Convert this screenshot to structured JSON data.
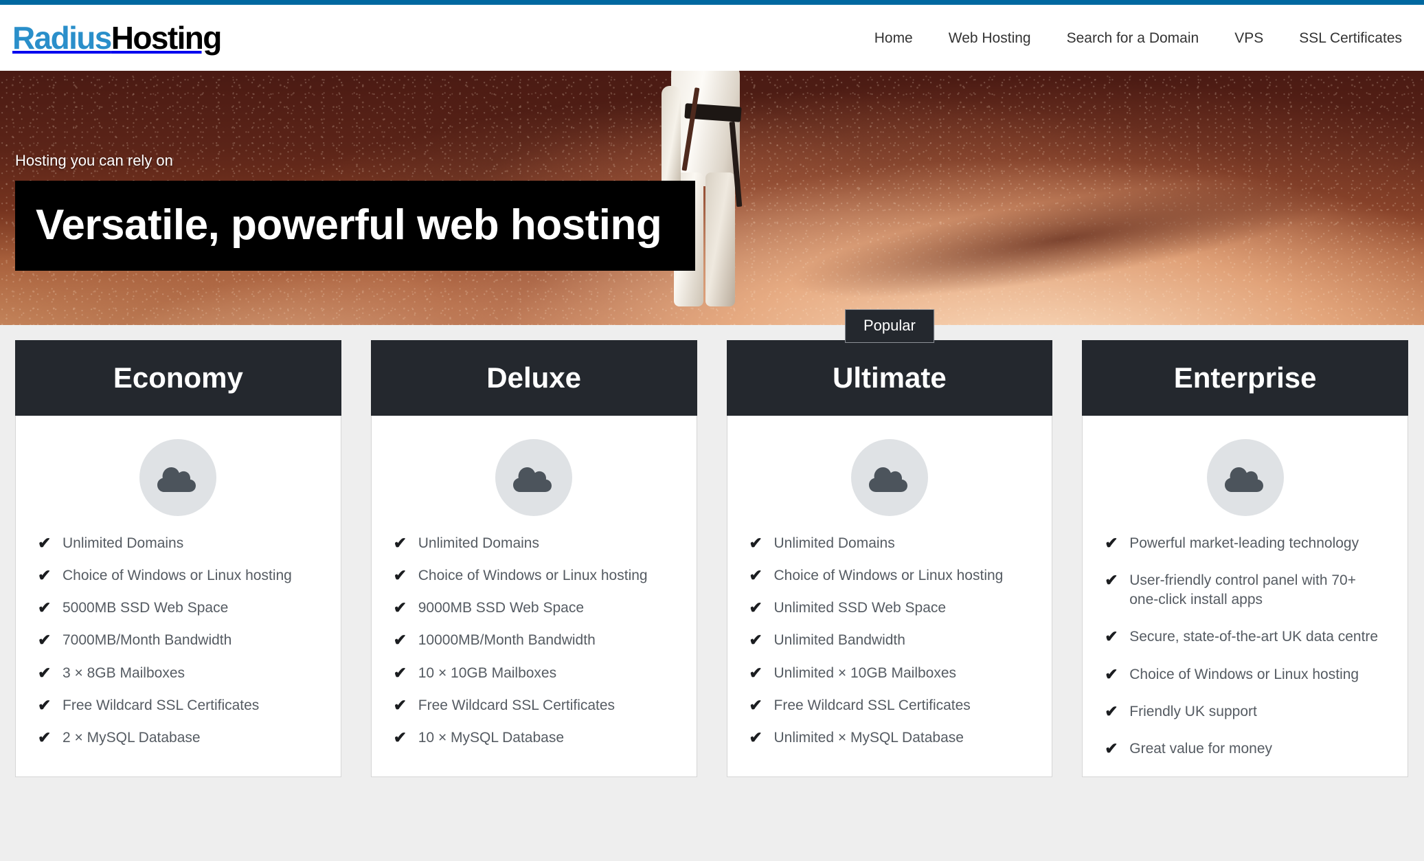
{
  "topbar": {
    "color": "#0068a0"
  },
  "header": {
    "logo": {
      "primary": "Radius",
      "secondary": "Hosting",
      "primary_color": "#2a8fca",
      "secondary_color": "#000000"
    },
    "nav": [
      {
        "label": "Home"
      },
      {
        "label": "Web Hosting"
      },
      {
        "label": "Search for a Domain"
      },
      {
        "label": "VPS"
      },
      {
        "label": "SSL Certificates"
      }
    ]
  },
  "hero": {
    "kicker": "Hosting you can rely on",
    "title": "Versatile, powerful web hosting",
    "image_description": "person in white protective suit standing on red rocky martian-like terrain"
  },
  "plans": {
    "badge_label": "Popular",
    "check_glyph": "✔",
    "icon_name": "cloud-icon",
    "cards": [
      {
        "name": "Economy",
        "popular": false,
        "features": [
          "Unlimited Domains",
          "Choice of Windows or Linux hosting",
          "5000MB SSD Web Space",
          "7000MB/Month Bandwidth",
          "3 × 8GB Mailboxes",
          "Free Wildcard SSL Certificates",
          "2 × MySQL Database"
        ]
      },
      {
        "name": "Deluxe",
        "popular": false,
        "features": [
          "Unlimited Domains",
          "Choice of Windows or Linux hosting",
          "9000MB SSD Web Space",
          "10000MB/Month Bandwidth",
          "10 × 10GB Mailboxes",
          "Free Wildcard SSL Certificates",
          "10 × MySQL Database"
        ]
      },
      {
        "name": "Ultimate",
        "popular": true,
        "features": [
          "Unlimited Domains",
          "Choice of Windows or Linux hosting",
          "Unlimited SSD Web Space",
          "Unlimited Bandwidth",
          "Unlimited × 10GB Mailboxes",
          "Free Wildcard SSL Certificates",
          "Unlimited × MySQL Database"
        ]
      },
      {
        "name": "Enterprise",
        "popular": false,
        "features": [
          "Powerful market-leading technology",
          "User-friendly control panel with 70+ one-click install apps",
          "Secure, state-of-the-art UK data centre",
          "Choice of Windows or Linux hosting",
          "Friendly UK support",
          "Great value for money"
        ]
      }
    ]
  },
  "colors": {
    "accent_blue": "#0068a0",
    "logo_blue": "#2a8fca",
    "card_header_dark": "#24282e",
    "page_bg": "#eeeeee",
    "icon_circle": "#dfe2e5",
    "icon_cloud": "#4c545c"
  }
}
